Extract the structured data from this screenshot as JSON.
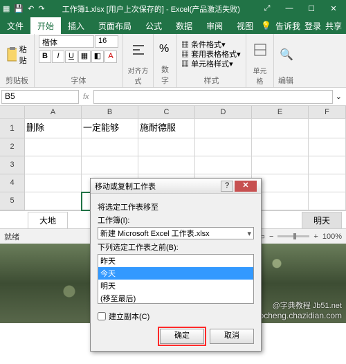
{
  "title_parts": {
    "filename": "工作簿1.xlsx",
    "saved": "[用户上次保存的]",
    "app": "- Excel(产品激活失败)"
  },
  "tabs": {
    "file": "文件",
    "home": "开始",
    "insert": "插入",
    "layout": "页面布局",
    "formulas": "公式",
    "data": "数据",
    "review": "审阅",
    "view": "视图",
    "tellme": "告诉我",
    "login": "登录",
    "share": "共享"
  },
  "ribbon": {
    "clipboard": {
      "paste": "粘贴",
      "label": "剪贴板"
    },
    "font": {
      "name": "楷体",
      "size": "16",
      "buttons": {
        "bold": "B",
        "italic": "I",
        "underline": "U"
      },
      "label": "字体"
    },
    "align": {
      "label": "对齐方式"
    },
    "number": {
      "label": "数字"
    },
    "styles": {
      "cond": "条件格式",
      "table": "套用表格格式",
      "cell": "单元格样式",
      "label": "样式"
    },
    "cells": {
      "label": "单元格"
    },
    "editing": {
      "label": "编辑"
    }
  },
  "namebox": "B5",
  "cols": [
    "A",
    "B",
    "C",
    "D",
    "E",
    "F"
  ],
  "rows": [
    "1",
    "2",
    "3",
    "4",
    "5"
  ],
  "cells": {
    "A1": "删除",
    "B1": "一定能够",
    "C1": "施耐德服"
  },
  "sheet_tabs": {
    "left1": "大地",
    "right1": "明天"
  },
  "status": {
    "ready": "就绪",
    "zoom": "100%"
  },
  "dialog": {
    "title": "移动或复制工作表",
    "moveto_label": "将选定工作表移至",
    "workbook_label": "工作簿(I):",
    "workbook_value": "新建 Microsoft Excel 工作表.xlsx",
    "before_label": "下列选定工作表之前(B):",
    "list": [
      "昨天",
      "今天",
      "明天",
      "(移至最后)"
    ],
    "selected_index": 1,
    "copy_label": "建立副本(C)",
    "ok": "确定",
    "cancel": "取消"
  },
  "watermark": {
    "line1": "@字典教程 Jb51.net",
    "line2": "jiaocheng.chazidian.com"
  }
}
